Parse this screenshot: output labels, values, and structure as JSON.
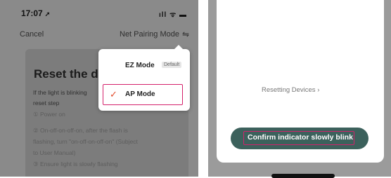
{
  "left": {
    "status": {
      "time": "17:07",
      "arrow": "➚",
      "icons": "ıll ᯤ ▬"
    },
    "nav": {
      "cancel": "Cancel",
      "title": "Net Pairing Mode",
      "swap_glyph": "⇋"
    },
    "card": {
      "title": "Reset the de",
      "lines": [
        "If the light is blinking",
        "reset step",
        "① Power on",
        "② On-off-on-off-on, after the flash is",
        "flashing, turn \"on-off-on-off-on\" (Subject",
        "to User Manual)",
        "③ Ensure light is slowly flashing"
      ]
    },
    "popup": {
      "ez_label": "EZ Mode",
      "ez_badge": "Default",
      "ap_label": "AP Mode",
      "check_glyph": "✓"
    }
  },
  "right": {
    "resetting_link": "Resetting Devices ›",
    "confirm_button": "Confirm indicator slowly blink"
  },
  "colors": {
    "highlight": "#d4216b",
    "button_bg": "#3c615c",
    "check": "#e24a2a"
  }
}
